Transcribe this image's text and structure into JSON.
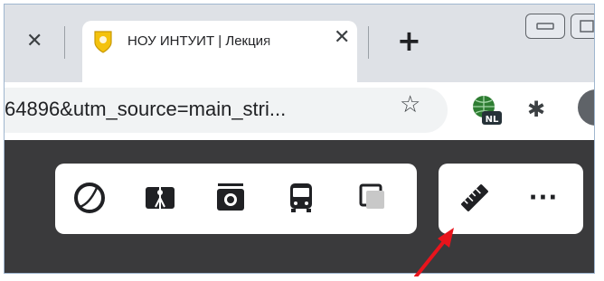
{
  "tab_strip": {
    "active_tab": {
      "title": "НОУ ИНТУИТ | Лекция",
      "close_label": "✕"
    },
    "prev_tab_close_label": "✕",
    "new_tab_label": "+"
  },
  "address_bar": {
    "url": "64896&utm_source=main_stri..."
  },
  "extensions": {
    "badge_text": "NL"
  },
  "page_toolbar": {
    "more_label": "···",
    "left_tools": [
      "circle-icon",
      "map-book-icon",
      "camera-icon",
      "bus-icon",
      "layers-icon"
    ],
    "right_tools": [
      "ruler-icon",
      "more-icon"
    ]
  },
  "colors": {
    "tabstrip_bg": "#dee1e6",
    "content_bg": "#3a3a3c",
    "arrow": "#e8141c",
    "globe_green": "#2e7d32",
    "badge_bg": "#263238"
  }
}
